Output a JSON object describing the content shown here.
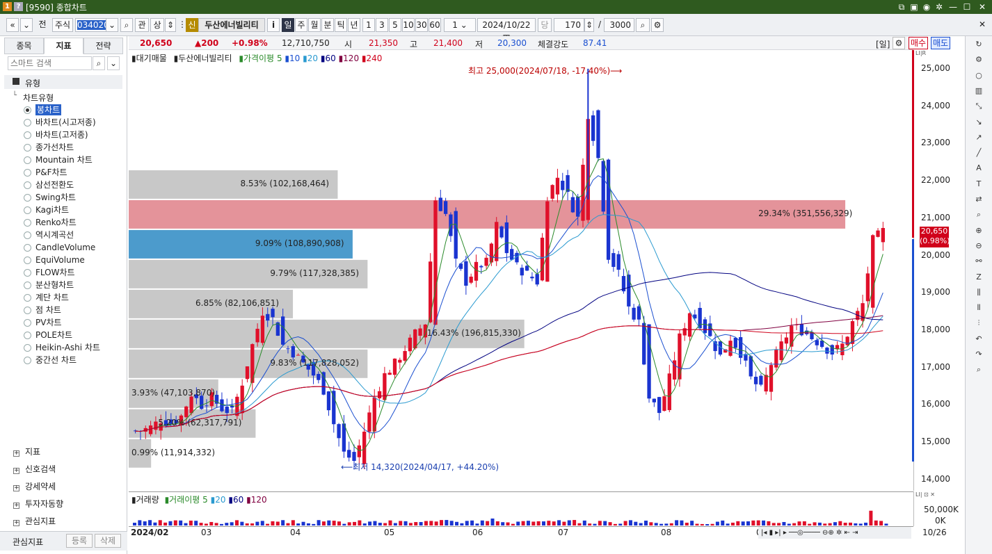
{
  "window": {
    "title": "[9590] 종합차트",
    "icon1": "1",
    "icon2": "?"
  },
  "toolbar": {
    "nav_prev": "«",
    "nav_down": "⌄",
    "jeon": "전",
    "market": "주식",
    "code": "034020",
    "search_icon": "⌕",
    "gwan": "관",
    "sang": "상",
    "badge": "신",
    "stock_name": "두산에너빌리티",
    "info": "i",
    "periods": [
      "일",
      "주",
      "월",
      "분",
      "틱",
      "년"
    ],
    "intervals": [
      "1",
      "3",
      "5",
      "10",
      "30",
      "60"
    ],
    "unit_value": "1",
    "date": "2024/10/22",
    "dang": "당",
    "count": "170",
    "slash": "/",
    "total": "3000"
  },
  "left": {
    "tabs": [
      "종목",
      "지표",
      "전략"
    ],
    "search_placeholder": "스마트 검색",
    "type_header": "유형",
    "chart_type_header": "차트유형",
    "chart_types": [
      "봉차트",
      "바차트(시고저종)",
      "바차트(고저종)",
      "종가선차트",
      "Mountain 차트",
      "P&F차트",
      "삼선전환도",
      "Swing차트",
      "Kagi차트",
      "Renko차트",
      "역시계곡선",
      "CandleVolume",
      "EquiVolume",
      "FLOW차트",
      "분산형차트",
      "계단 차트",
      "점 차트",
      "PV차트",
      "POLE차트",
      "Heikin-Ashi 차트",
      "중간선 차트"
    ],
    "selected_type": "봉차트",
    "sections": [
      "지표",
      "신호검색",
      "강세약세",
      "투자자동향",
      "관심지표"
    ],
    "footer_label": "관심지표",
    "footer_add": "등록",
    "footer_del": "삭제"
  },
  "info": {
    "price": "20,650",
    "change": "▲200",
    "pct": "+0.98%",
    "volume": "12,710,750",
    "open_label": "시",
    "open": "21,350",
    "high_label": "고",
    "high": "21,400",
    "low_label": "저",
    "low": "20,300",
    "strength_label": "체결강도",
    "strength": "87.41",
    "day_label": "[일]",
    "buy": "매수",
    "sell": "매도"
  },
  "legend": {
    "main": "대기매물",
    "stock": "두산에너빌리티",
    "ma_label": "가격이평",
    "ma": [
      "5",
      "10",
      "20",
      "60",
      "120",
      "240"
    ]
  },
  "annotations": {
    "high": "최고 25,000(2024/07/18, -17.40%)⟶",
    "low": "⟵최저 14,320(2024/04/17, +44.20%)"
  },
  "yaxis": {
    "ticks": [
      "25,000",
      "24,000",
      "23,000",
      "22,000",
      "21,000",
      "20,000",
      "19,000",
      "18,000",
      "17,000",
      "16,000",
      "15,000",
      "14,000"
    ],
    "current": "20,650",
    "current_pct": "(0.98%)"
  },
  "volume_profile": [
    {
      "label": "8.53% (102,168,464)",
      "low": 21500,
      "high": 22300,
      "frac": 0.28,
      "color": "#c8c8c8"
    },
    {
      "label": "29.34% (351,556,329)",
      "low": 20700,
      "high": 21500,
      "frac": 0.96,
      "color": "#e4939a"
    },
    {
      "label": "9.09% (108,890,908)",
      "low": 19900,
      "high": 20700,
      "frac": 0.3,
      "color": "#4c9bcc"
    },
    {
      "label": "9.79% (117,328,385)",
      "low": 19100,
      "high": 19900,
      "frac": 0.32,
      "color": "#c8c8c8"
    },
    {
      "label": "6.85% (82,106,851)",
      "low": 18300,
      "high": 19100,
      "frac": 0.22,
      "color": "#c8c8c8"
    },
    {
      "label": "16.43% (196,815,330)",
      "low": 17500,
      "high": 18300,
      "frac": 0.53,
      "color": "#c8c8c8"
    },
    {
      "label": "9.83% (117,828,052)",
      "low": 16700,
      "high": 17500,
      "frac": 0.32,
      "color": "#c8c8c8"
    },
    {
      "label": "3.93% (47,103,870)",
      "low": 15900,
      "high": 16700,
      "frac": 0.12,
      "color": "#c8c8c8"
    },
    {
      "label": "5.20% (62,317,791)",
      "low": 15100,
      "high": 15900,
      "frac": 0.17,
      "color": "#c8c8c8"
    },
    {
      "label": "0.99% (11,914,332)",
      "low": 14300,
      "high": 15100,
      "frac": 0.03,
      "color": "#c8c8c8"
    }
  ],
  "volume_legend": {
    "main": "거래량",
    "ma_label": "거래이평",
    "ma": [
      "5",
      "20",
      "60",
      "120"
    ]
  },
  "volume_axis": [
    "50,000K",
    "0K"
  ],
  "xaxis": {
    "labels": [
      "2024/02",
      "03",
      "04",
      "05",
      "06",
      "07",
      "08",
      "09",
      "10"
    ],
    "last": "10/26"
  },
  "chart_data": {
    "type": "candlestick",
    "title": "두산에너빌리티",
    "ylim": [
      13700,
      25500
    ],
    "x_months": [
      "2024/02",
      "03",
      "04",
      "05",
      "06",
      "07",
      "08",
      "09",
      "10"
    ],
    "close_path": [
      15300,
      15400,
      15600,
      15500,
      15700,
      16300,
      16000,
      16200,
      15900,
      15800,
      16600,
      17600,
      18500,
      18300,
      17600,
      17400,
      17100,
      16800,
      16400,
      15500,
      14700,
      14500,
      15300,
      16200,
      16800,
      17100,
      17500,
      17900,
      18200,
      21500,
      21100,
      19800,
      19300,
      19700,
      19800,
      20800,
      20100,
      19700,
      19500,
      19300,
      21600,
      22100,
      21600,
      21000,
      23800,
      22600,
      20000,
      19500,
      18600,
      18200,
      16200,
      15800,
      16700,
      17800,
      18500,
      18200,
      17800,
      17300,
      17800,
      17400,
      16700,
      16400,
      17100,
      17600,
      18100,
      18000,
      17800,
      17600,
      17400,
      17600,
      18200,
      18700,
      20400,
      20650
    ],
    "highlights": {
      "max": 25000,
      "min": 14320,
      "last": 20650
    }
  },
  "icons": {
    "search": "search-icon",
    "gear": "gear-icon",
    "close": "close-icon"
  }
}
